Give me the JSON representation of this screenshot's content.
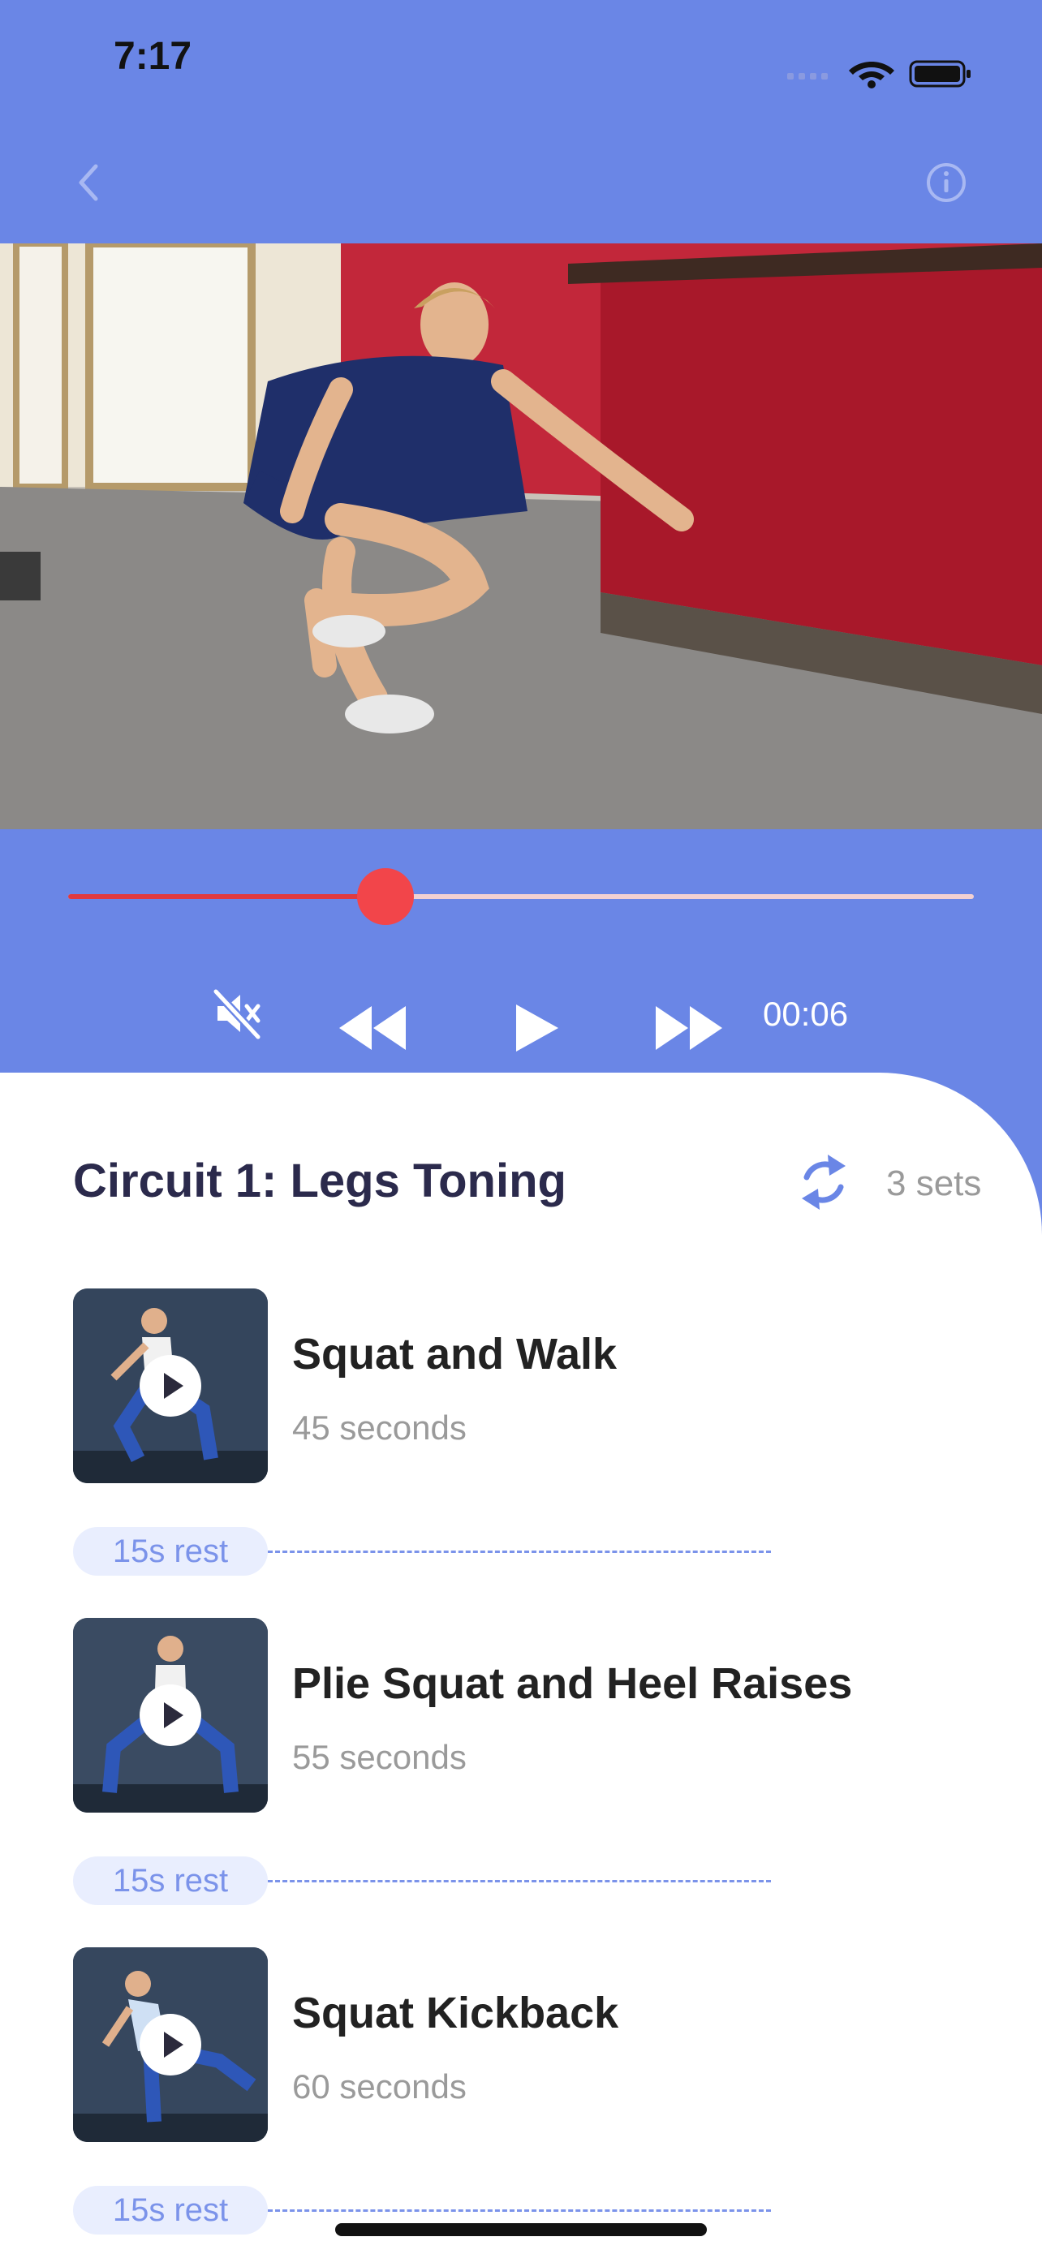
{
  "status_bar": {
    "time": "7:17"
  },
  "player": {
    "progress": 0.35,
    "elapsed": "00:06"
  },
  "circuit": {
    "title": "Circuit 1: Legs Toning",
    "sets_label": "3 sets",
    "exercises": [
      {
        "name": "Squat and Walk",
        "duration": "45 seconds",
        "rest": "15s rest"
      },
      {
        "name": "Plie Squat and Heel Raises",
        "duration": "55 seconds",
        "rest": "15s rest"
      },
      {
        "name": "Squat Kickback",
        "duration": "60 seconds",
        "rest": "15s rest"
      }
    ]
  },
  "colors": {
    "header_bg": "#6a86e6",
    "accent_red": "#f2454a",
    "title_text": "#2b2a4c",
    "rest_pill_bg": "#e9eefe",
    "rest_text": "#7b93ea"
  },
  "icons": [
    "back-chevron-icon",
    "info-icon",
    "mute-icon",
    "rewind-icon",
    "play-icon",
    "fast-forward-icon",
    "repeat-icon",
    "play-circle-icon"
  ]
}
